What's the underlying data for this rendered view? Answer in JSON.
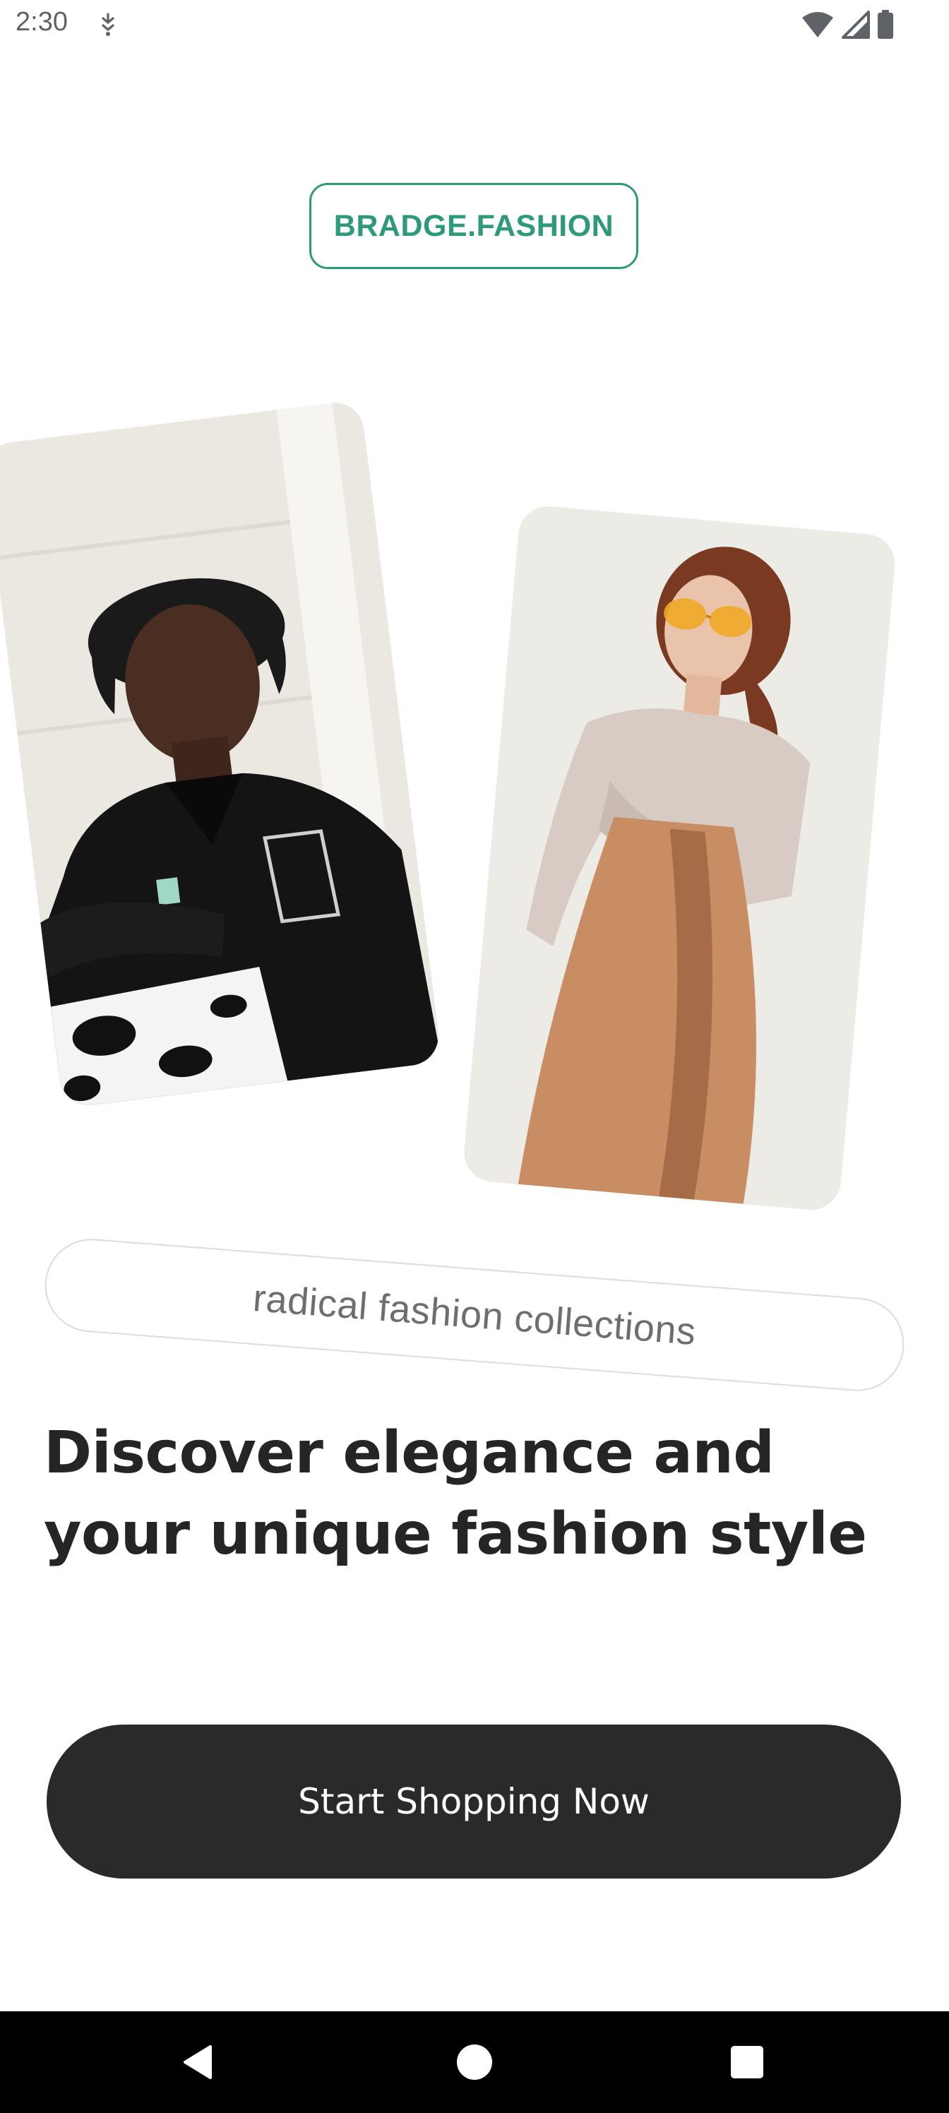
{
  "status_bar": {
    "time": "2:30",
    "icons": [
      "notification-icon",
      "wifi-icon",
      "signal-icon",
      "battery-icon"
    ]
  },
  "brand": {
    "name": "BRADGE.FASHION",
    "color": "#2e9a78"
  },
  "photos": [
    {
      "name": "male-model-photo",
      "description_icon": "photo-icon"
    },
    {
      "name": "female-model-photo",
      "description_icon": "photo-icon"
    }
  ],
  "tagline": "radical fashion collections",
  "headline": "Discover elegance and your unique fashion style",
  "cta": {
    "label": "Start Shopping Now",
    "background": "#2a2a2a"
  },
  "nav_bar": {
    "buttons": [
      "back-icon",
      "home-icon",
      "recents-icon"
    ]
  }
}
